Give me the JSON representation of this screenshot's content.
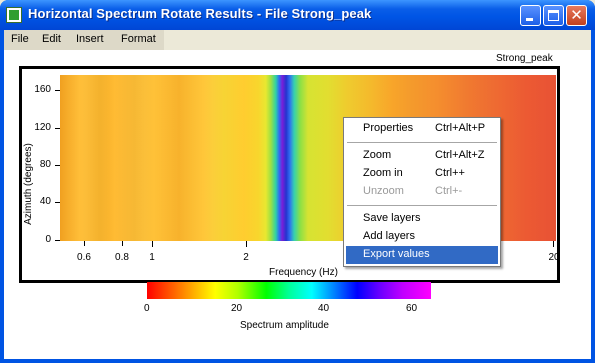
{
  "window": {
    "title": "Horizontal Spectrum Rotate Results - File Strong_peak",
    "close_glyph": "✕"
  },
  "menu": {
    "items": [
      "File",
      "Edit",
      "Insert",
      "Format"
    ]
  },
  "plot": {
    "title": "Strong_peak",
    "y_label": "Azimuth (degrees)",
    "x_label": "Frequency (Hz)",
    "y_ticks": [
      "0",
      "40",
      "80",
      "120",
      "160"
    ],
    "x_ticks": [
      "0.6",
      "0.8",
      "1",
      "2",
      "20"
    ],
    "colorbar": {
      "title": "Spectrum amplitude",
      "ticks": [
        "0",
        "20",
        "40",
        "60"
      ]
    }
  },
  "context_menu": {
    "items": [
      {
        "label": "Properties",
        "shortcut": "Ctrl+Alt+P"
      },
      {
        "label": "Zoom",
        "shortcut": "Ctrl+Alt+Z"
      },
      {
        "label": "Zoom in",
        "shortcut": "Ctrl++"
      },
      {
        "label": "Unzoom",
        "shortcut": "Ctrl+-",
        "disabled": true
      },
      {
        "label": "Save layers",
        "shortcut": ""
      },
      {
        "label": "Add layers",
        "shortcut": ""
      },
      {
        "label": "Export values",
        "shortcut": "",
        "selected": true
      }
    ]
  },
  "colors": {
    "titlebar": "#0055e5",
    "selection": "#316ac5"
  },
  "icons": [
    "app-icon",
    "minimize-icon",
    "maximize-icon",
    "close-icon"
  ]
}
